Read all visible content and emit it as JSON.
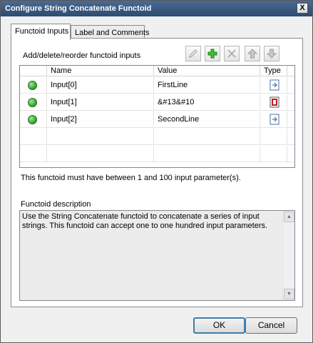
{
  "window": {
    "title": "Configure String Concatenate Functoid",
    "close_glyph": "X"
  },
  "tabs": [
    {
      "label": "Functoid Inputs",
      "active": true
    },
    {
      "label": "Label and Comments",
      "active": false
    }
  ],
  "inputs_section": {
    "label": "Add/delete/reorder functoid inputs"
  },
  "toolbar": {
    "edit_icon": "pencil-icon",
    "add_icon": "plus-icon",
    "delete_icon": "delete-x-icon",
    "move_up_icon": "arrow-up-icon",
    "move_down_icon": "arrow-down-icon"
  },
  "grid": {
    "columns": [
      "",
      "Name",
      "Value",
      "Type"
    ],
    "rows": [
      {
        "status_icon": "green-check-icon",
        "name": "Input[0]",
        "value": "FirstLine",
        "type_icon": "constant-type-icon"
      },
      {
        "status_icon": "green-check-icon",
        "name": "Input[1]",
        "value": "&#13&#10",
        "type_icon": "constant-red-type-icon"
      },
      {
        "status_icon": "green-check-icon",
        "name": "Input[2]",
        "value": "SecondLine",
        "type_icon": "constant-type-icon"
      }
    ]
  },
  "constraint_text": "This functoid must have between 1 and 100 input parameter(s).",
  "description": {
    "label": "Functoid description",
    "text": "Use the String Concatenate functoid to concatenate a series of input strings. This functoid can accept one to one hundred input parameters."
  },
  "buttons": {
    "ok": "OK",
    "cancel": "Cancel"
  },
  "colors": {
    "titlebar": "#3a5a82",
    "accent_green": "#2f9b2a",
    "focus_border": "#3c7fb1"
  }
}
